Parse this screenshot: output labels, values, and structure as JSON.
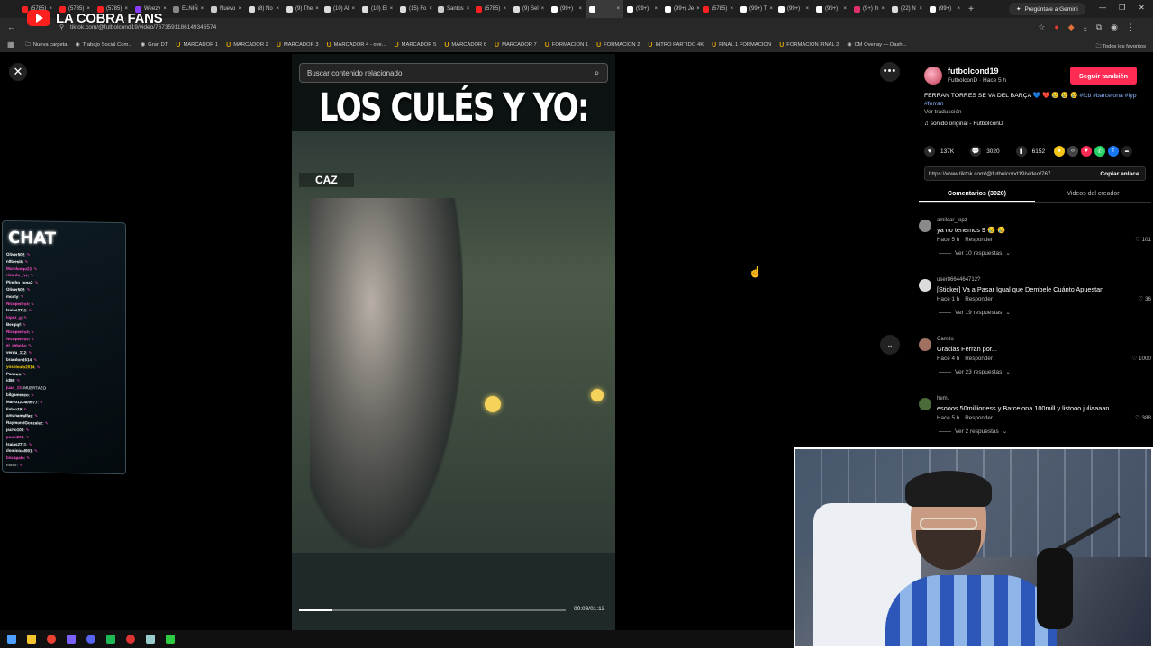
{
  "browser": {
    "tabs": [
      {
        "label": "(5785)",
        "icon": "youtube-icon",
        "color": "#ff2020"
      },
      {
        "label": "(5785)",
        "icon": "youtube-icon",
        "color": "#ff2020"
      },
      {
        "label": "(5785)",
        "icon": "youtube-icon",
        "color": "#ff2020"
      },
      {
        "label": "Weezy",
        "icon": "yahoo-icon",
        "color": "#8b3dff"
      },
      {
        "label": "ELNIÑ",
        "icon": "page-icon",
        "color": "#888888"
      },
      {
        "label": "Nuevo",
        "icon": "globe-icon",
        "color": "#cccccc"
      },
      {
        "label": "(8) No",
        "icon": "x-icon",
        "color": "#dddddd"
      },
      {
        "label": "(9) The",
        "icon": "x-icon",
        "color": "#dddddd"
      },
      {
        "label": "(10) Al",
        "icon": "x-icon",
        "color": "#dddddd"
      },
      {
        "label": "(10) El",
        "icon": "x-icon",
        "color": "#dddddd"
      },
      {
        "label": "(15) Fo",
        "icon": "x-icon",
        "color": "#dddddd"
      },
      {
        "label": "Santos",
        "icon": "page-icon",
        "color": "#cccccc"
      },
      {
        "label": "(5785)",
        "icon": "youtube-icon",
        "color": "#ff2020"
      },
      {
        "label": "(9) Sel",
        "icon": "x-icon",
        "color": "#dddddd"
      },
      {
        "label": "(99+)",
        "icon": "tiktok-icon",
        "color": "#ffffff"
      },
      {
        "label": "",
        "icon": "tiktok-icon",
        "color": "#ffffff",
        "active": true
      },
      {
        "label": "(99+)",
        "icon": "tiktok-icon",
        "color": "#ffffff"
      },
      {
        "label": "(99+) Je",
        "icon": "tiktok-icon",
        "color": "#ffffff"
      },
      {
        "label": "(5785)",
        "icon": "youtube-icon",
        "color": "#ff2020"
      },
      {
        "label": "(99+) T",
        "icon": "tiktok-icon",
        "color": "#ffffff"
      },
      {
        "label": "(99+)",
        "icon": "tiktok-icon",
        "color": "#ffffff"
      },
      {
        "label": "(99+)",
        "icon": "tiktok-icon",
        "color": "#ffffff"
      },
      {
        "label": "(9+) In",
        "icon": "instagram-icon",
        "color": "#e1306c"
      },
      {
        "label": "(22) N",
        "icon": "x-icon",
        "color": "#dddddd"
      },
      {
        "label": "(99+)",
        "icon": "tiktok-icon",
        "color": "#ffffff"
      }
    ],
    "new_tab": "+",
    "gemini_label": "Pregúntale a Gemini",
    "url": "tiktok.com/@futbolcond19/video/7673591186149346574",
    "bookmarks": [
      {
        "label": "Nueva carpeta",
        "icon": "folder-icon"
      },
      {
        "label": "Trabajo Social Com...",
        "icon": "page-icon"
      },
      {
        "label": "Gran DT",
        "icon": "globe-icon"
      },
      {
        "label": "MARCADOR 1",
        "icon": "u-icon"
      },
      {
        "label": "MARCADOR 2",
        "icon": "u-icon"
      },
      {
        "label": "MARCADOR 3",
        "icon": "u-icon"
      },
      {
        "label": "MARCADOR 4 - ove...",
        "icon": "u-icon"
      },
      {
        "label": "MARCADOR 5",
        "icon": "u-icon"
      },
      {
        "label": "MARCADOR 6",
        "icon": "u-icon"
      },
      {
        "label": "MARCADOR 7",
        "icon": "u-icon"
      },
      {
        "label": "FORMACION 1",
        "icon": "u-icon"
      },
      {
        "label": "FORMACION 2",
        "icon": "u-icon"
      },
      {
        "label": "INTRO PARTIDO 4K",
        "icon": "u-icon"
      },
      {
        "label": "FINAL 1 FORMACION",
        "icon": "u-icon"
      },
      {
        "label": "FORMACION FINAL 2",
        "icon": "u-icon"
      },
      {
        "label": "CM Overlay — Dash...",
        "icon": "page-icon"
      }
    ],
    "all_bookmarks": "Todos los favoritos"
  },
  "overlay": {
    "channel_title": "LA COBRA FANS"
  },
  "video": {
    "search_placeholder": "Buscar contenido relacionado",
    "headline": "LOS CULÉS Y YO:",
    "score_text": "CAZ",
    "time": "00:09/01:12",
    "progress": 0.125
  },
  "post": {
    "author": "futbolcond19",
    "author_sub": "FutbolconD · Hace 5 h",
    "follow_label": "Seguir también",
    "caption_text": "FERRAN TORRES SE VA DEL BARÇA 💙 ❤️ 😢 😢 😢",
    "caption_tags": "#fcb #barcelona #fyp #ferran",
    "translate_label": "Ver traducción",
    "sound": "sonido original - FutbolconD",
    "likes": "137K",
    "comments": "3020",
    "saves": "6152",
    "link": "https://www.tiktok.com/@futbolcond19/video/767...",
    "copy_label": "Copiar enlace",
    "share_colors": [
      "#f5c518",
      "#444444",
      "#fe2c55",
      "#25d366",
      "#1877f2",
      "#222222"
    ]
  },
  "panel_tabs": {
    "comments": "Comentarios (3020)",
    "creator_videos": "Videos del creador"
  },
  "comments": [
    {
      "user": "amilcar_lopz",
      "text": "ya no tenemos 9 😢 😢",
      "time": "Hace 5 h",
      "reply": "Responder",
      "likes": "101",
      "replies": "Ver 10 respuestas",
      "avatar_color": "#8a8a8a"
    },
    {
      "user": "user8664464712?",
      "text": "[Sticker] Va a Pasar Igual que Dembele Cuánto Apuestan",
      "time": "Hace 1 h",
      "reply": "Responder",
      "likes": "36",
      "replies": "Ver 19 respuestas",
      "avatar_color": "#dcdcdc"
    },
    {
      "user": "Camilo",
      "text": "Gracias Ferran por...",
      "time": "Hace 4 h",
      "reply": "Responder",
      "likes": "1000",
      "replies": "Ver 23 respuestas",
      "avatar_color": "#a07060"
    },
    {
      "user": "hem.",
      "text": "esooos 50millioness y Barcelona 100mill y listooo juliaaaan",
      "time": "Hace 5 h",
      "reply": "Responder",
      "likes": "388",
      "replies": "Ver 2 respuestas",
      "avatar_color": "#4a6a3a"
    }
  ],
  "chat": {
    "title": "CHAT",
    "lines": [
      {
        "name": "Oliver502",
        "color": "#ffffff"
      },
      {
        "name": "n0blesik",
        "color": "#ffffff"
      },
      {
        "name": "Mondongo23",
        "color": "#ff4fc8"
      },
      {
        "name": "ricardo_fvz",
        "color": "#ff4fc8"
      },
      {
        "name": "Pincho_lona2",
        "color": "#ffffff"
      },
      {
        "name": "Oliver502",
        "color": "#ffffff"
      },
      {
        "name": "moxty",
        "color": "#ffffff"
      },
      {
        "name": "Nicopedro4",
        "color": "#ff4fc8"
      },
      {
        "name": "Isaias2711",
        "color": "#ffffff"
      },
      {
        "name": "lopez_g",
        "color": "#ff4fc8"
      },
      {
        "name": "Bergiqf",
        "color": "#ffffff"
      },
      {
        "name": "Nicopedro4",
        "color": "#ff4fc8"
      },
      {
        "name": "Nicopedro4",
        "color": "#ff4fc8"
      },
      {
        "name": "el_cebolla",
        "color": "#ff4fc8"
      },
      {
        "name": "verdu_112",
        "color": "#ffffff"
      },
      {
        "name": "brandon1614",
        "color": "#ffffff"
      },
      {
        "name": "yosoloulo2014",
        "color": "#ffd400"
      },
      {
        "name": "Pancus",
        "color": "#ffffff"
      },
      {
        "name": "id86",
        "color": "#ffffff"
      },
      {
        "name": "juan_13",
        "color": "#ff4fc8",
        "message": "MUERTAZO"
      },
      {
        "name": "bilgamenzo",
        "color": "#ffffff"
      },
      {
        "name": "Mario123409977",
        "color": "#ffffff"
      },
      {
        "name": "Fabio19",
        "color": "#ffffff"
      },
      {
        "name": "amunamalfas",
        "color": "#ffffff"
      },
      {
        "name": "RaymondGonzalez",
        "color": "#ffffff"
      },
      {
        "name": "jacho100",
        "color": "#ffffff"
      },
      {
        "name": "pucci200",
        "color": "#ff4fc8"
      },
      {
        "name": "Isaias2711",
        "color": "#ffffff"
      },
      {
        "name": "dominical901",
        "color": "#ffffff"
      },
      {
        "name": "bocapalo",
        "color": "#ff4fc8"
      },
      {
        "name": "mxcv",
        "color": "#aaaaaa"
      }
    ]
  },
  "colors": {
    "follow": "#fe2c55",
    "tag": "#8ab6ff",
    "overlay_red": "#ff1f1f"
  }
}
